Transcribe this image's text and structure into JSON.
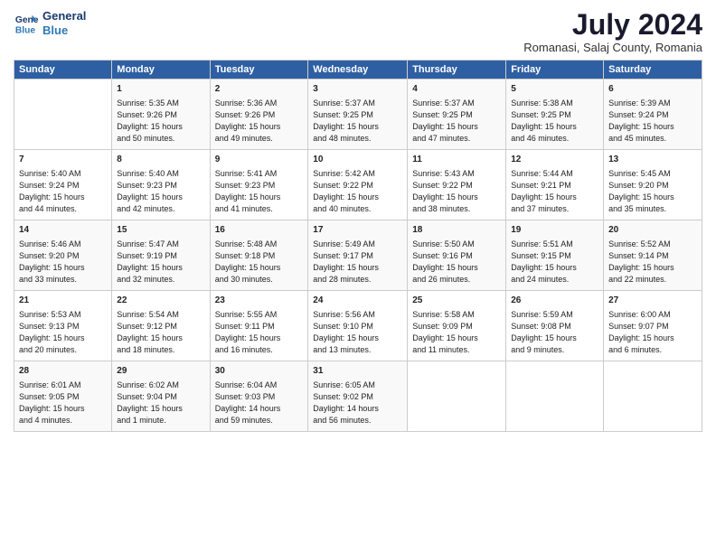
{
  "header": {
    "logo_line1": "General",
    "logo_line2": "Blue",
    "month": "July 2024",
    "location": "Romanasi, Salaj County, Romania"
  },
  "days_of_week": [
    "Sunday",
    "Monday",
    "Tuesday",
    "Wednesday",
    "Thursday",
    "Friday",
    "Saturday"
  ],
  "weeks": [
    [
      {
        "day": "",
        "content": ""
      },
      {
        "day": "1",
        "content": "Sunrise: 5:35 AM\nSunset: 9:26 PM\nDaylight: 15 hours\nand 50 minutes."
      },
      {
        "day": "2",
        "content": "Sunrise: 5:36 AM\nSunset: 9:26 PM\nDaylight: 15 hours\nand 49 minutes."
      },
      {
        "day": "3",
        "content": "Sunrise: 5:37 AM\nSunset: 9:25 PM\nDaylight: 15 hours\nand 48 minutes."
      },
      {
        "day": "4",
        "content": "Sunrise: 5:37 AM\nSunset: 9:25 PM\nDaylight: 15 hours\nand 47 minutes."
      },
      {
        "day": "5",
        "content": "Sunrise: 5:38 AM\nSunset: 9:25 PM\nDaylight: 15 hours\nand 46 minutes."
      },
      {
        "day": "6",
        "content": "Sunrise: 5:39 AM\nSunset: 9:24 PM\nDaylight: 15 hours\nand 45 minutes."
      }
    ],
    [
      {
        "day": "7",
        "content": "Sunrise: 5:40 AM\nSunset: 9:24 PM\nDaylight: 15 hours\nand 44 minutes."
      },
      {
        "day": "8",
        "content": "Sunrise: 5:40 AM\nSunset: 9:23 PM\nDaylight: 15 hours\nand 42 minutes."
      },
      {
        "day": "9",
        "content": "Sunrise: 5:41 AM\nSunset: 9:23 PM\nDaylight: 15 hours\nand 41 minutes."
      },
      {
        "day": "10",
        "content": "Sunrise: 5:42 AM\nSunset: 9:22 PM\nDaylight: 15 hours\nand 40 minutes."
      },
      {
        "day": "11",
        "content": "Sunrise: 5:43 AM\nSunset: 9:22 PM\nDaylight: 15 hours\nand 38 minutes."
      },
      {
        "day": "12",
        "content": "Sunrise: 5:44 AM\nSunset: 9:21 PM\nDaylight: 15 hours\nand 37 minutes."
      },
      {
        "day": "13",
        "content": "Sunrise: 5:45 AM\nSunset: 9:20 PM\nDaylight: 15 hours\nand 35 minutes."
      }
    ],
    [
      {
        "day": "14",
        "content": "Sunrise: 5:46 AM\nSunset: 9:20 PM\nDaylight: 15 hours\nand 33 minutes."
      },
      {
        "day": "15",
        "content": "Sunrise: 5:47 AM\nSunset: 9:19 PM\nDaylight: 15 hours\nand 32 minutes."
      },
      {
        "day": "16",
        "content": "Sunrise: 5:48 AM\nSunset: 9:18 PM\nDaylight: 15 hours\nand 30 minutes."
      },
      {
        "day": "17",
        "content": "Sunrise: 5:49 AM\nSunset: 9:17 PM\nDaylight: 15 hours\nand 28 minutes."
      },
      {
        "day": "18",
        "content": "Sunrise: 5:50 AM\nSunset: 9:16 PM\nDaylight: 15 hours\nand 26 minutes."
      },
      {
        "day": "19",
        "content": "Sunrise: 5:51 AM\nSunset: 9:15 PM\nDaylight: 15 hours\nand 24 minutes."
      },
      {
        "day": "20",
        "content": "Sunrise: 5:52 AM\nSunset: 9:14 PM\nDaylight: 15 hours\nand 22 minutes."
      }
    ],
    [
      {
        "day": "21",
        "content": "Sunrise: 5:53 AM\nSunset: 9:13 PM\nDaylight: 15 hours\nand 20 minutes."
      },
      {
        "day": "22",
        "content": "Sunrise: 5:54 AM\nSunset: 9:12 PM\nDaylight: 15 hours\nand 18 minutes."
      },
      {
        "day": "23",
        "content": "Sunrise: 5:55 AM\nSunset: 9:11 PM\nDaylight: 15 hours\nand 16 minutes."
      },
      {
        "day": "24",
        "content": "Sunrise: 5:56 AM\nSunset: 9:10 PM\nDaylight: 15 hours\nand 13 minutes."
      },
      {
        "day": "25",
        "content": "Sunrise: 5:58 AM\nSunset: 9:09 PM\nDaylight: 15 hours\nand 11 minutes."
      },
      {
        "day": "26",
        "content": "Sunrise: 5:59 AM\nSunset: 9:08 PM\nDaylight: 15 hours\nand 9 minutes."
      },
      {
        "day": "27",
        "content": "Sunrise: 6:00 AM\nSunset: 9:07 PM\nDaylight: 15 hours\nand 6 minutes."
      }
    ],
    [
      {
        "day": "28",
        "content": "Sunrise: 6:01 AM\nSunset: 9:05 PM\nDaylight: 15 hours\nand 4 minutes."
      },
      {
        "day": "29",
        "content": "Sunrise: 6:02 AM\nSunset: 9:04 PM\nDaylight: 15 hours\nand 1 minute."
      },
      {
        "day": "30",
        "content": "Sunrise: 6:04 AM\nSunset: 9:03 PM\nDaylight: 14 hours\nand 59 minutes."
      },
      {
        "day": "31",
        "content": "Sunrise: 6:05 AM\nSunset: 9:02 PM\nDaylight: 14 hours\nand 56 minutes."
      },
      {
        "day": "",
        "content": ""
      },
      {
        "day": "",
        "content": ""
      },
      {
        "day": "",
        "content": ""
      }
    ]
  ]
}
